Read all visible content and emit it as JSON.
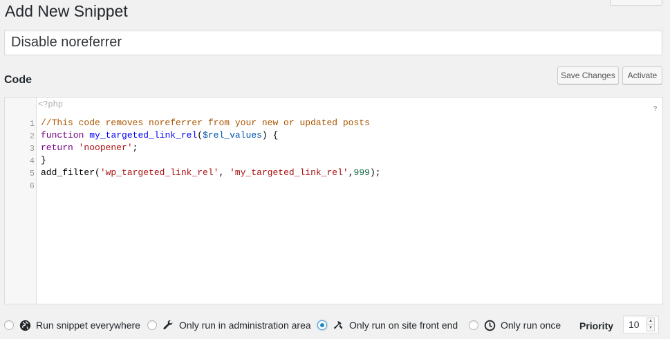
{
  "page": {
    "title": "Add New Snippet"
  },
  "snippet": {
    "title_value": "Disable noreferrer"
  },
  "code_section": {
    "heading": "Code",
    "save_label": "Save Changes",
    "activate_label": "Activate",
    "php_open_tag": "<?php",
    "help_mark": "?",
    "line_numbers": [
      "1",
      "2",
      "3",
      "4",
      "5",
      "6"
    ],
    "lines": {
      "l1_comment": "//This code removes noreferrer from your new or updated posts",
      "l2_keyword": "function",
      "l2_def": "my_targeted_link_rel",
      "l2_open": "(",
      "l2_var": "$rel_values",
      "l2_close": ") {",
      "l3_keyword": "return",
      "l3_string": "'noopener'",
      "l3_end": ";",
      "l4": "}",
      "l5_fn": "add_filter(",
      "l5_str1": "'wp_targeted_link_rel'",
      "l5_sep": ", ",
      "l5_str2": "'my_targeted_link_rel'",
      "l5_comma": ",",
      "l5_num": "999",
      "l5_end": ");"
    }
  },
  "scope_options": [
    {
      "label": "Run snippet everywhere",
      "icon": "globe-icon",
      "checked": false
    },
    {
      "label": "Only run in administration area",
      "icon": "wrench-icon",
      "checked": false
    },
    {
      "label": "Only run on site front end",
      "icon": "hammer-icon",
      "checked": true
    },
    {
      "label": "Only run once",
      "icon": "clock-icon",
      "checked": false
    }
  ],
  "priority": {
    "label": "Priority",
    "value": "10"
  },
  "colors": {
    "accent": "#1e8cbe",
    "background": "#f1f1f1"
  }
}
